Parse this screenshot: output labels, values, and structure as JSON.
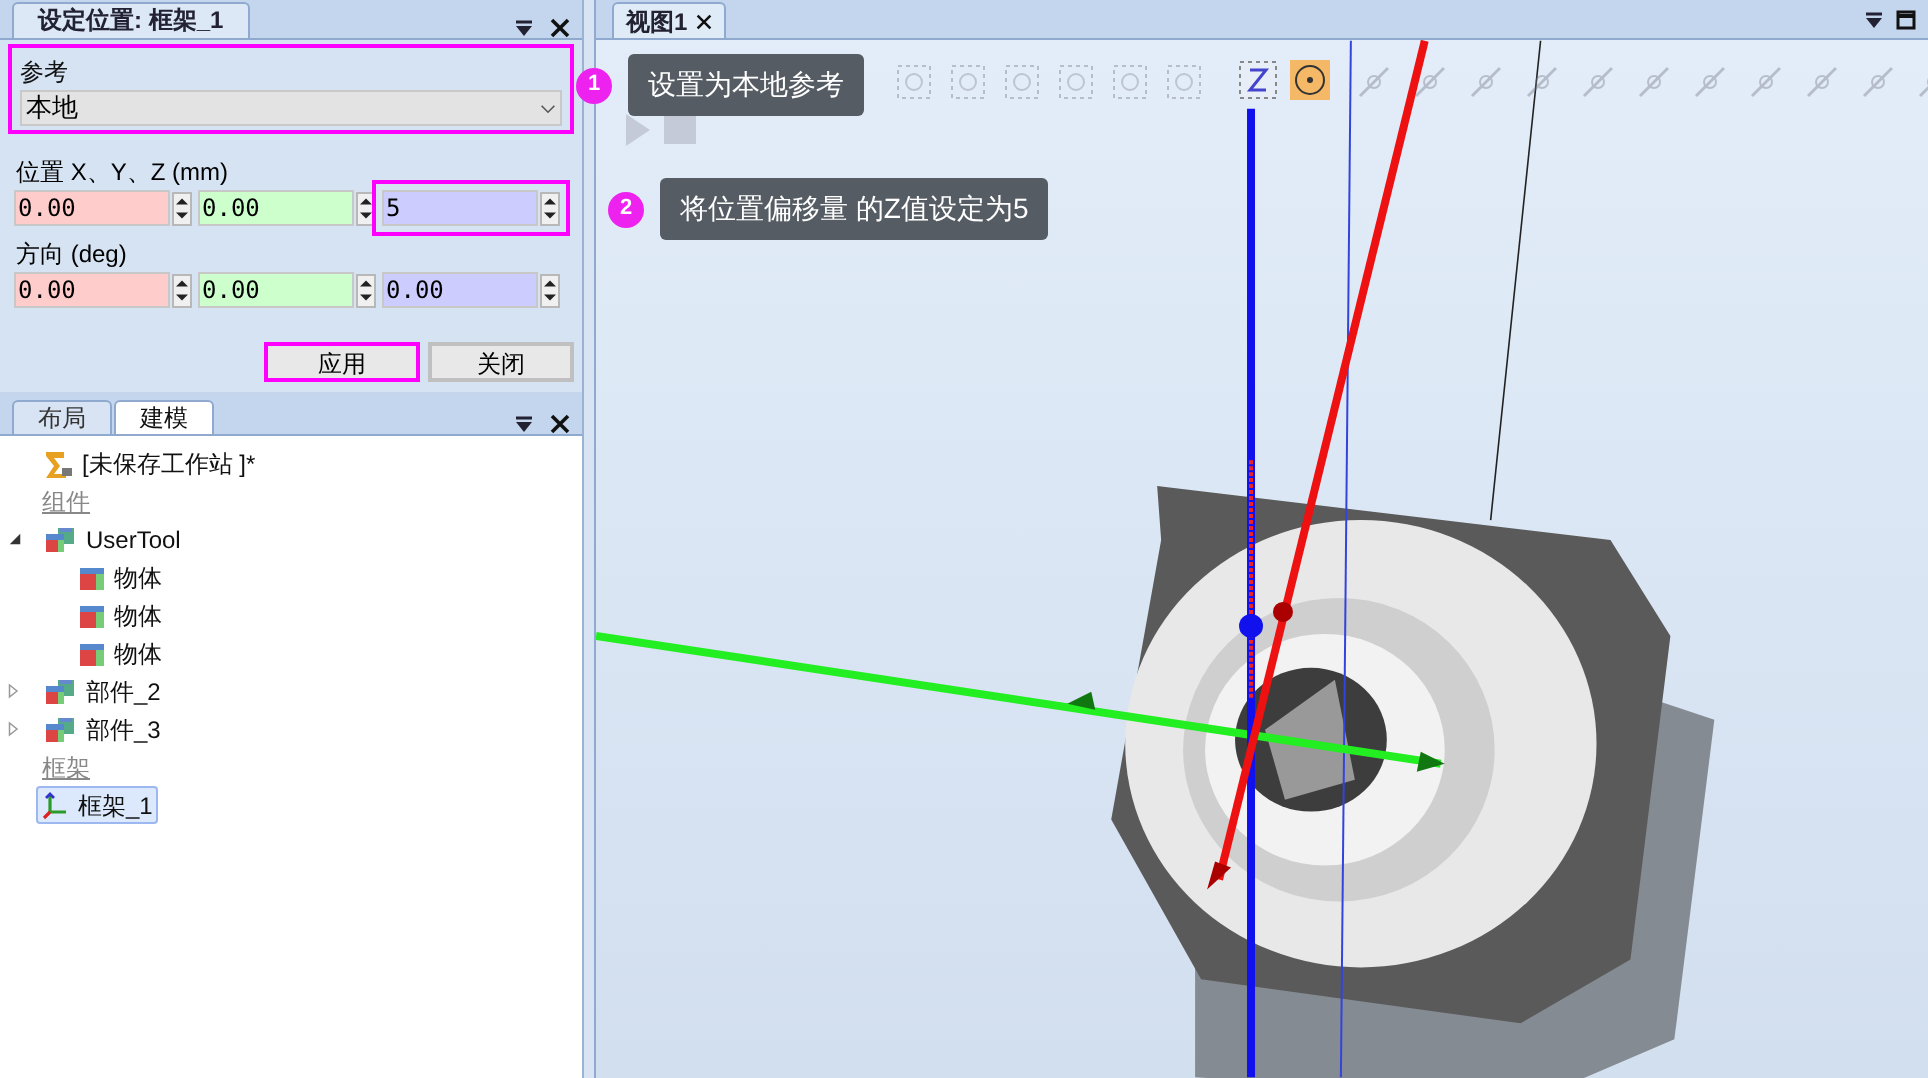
{
  "position_panel": {
    "title": "设定位置: 框架_1",
    "reference": {
      "label": "参考",
      "value": "本地",
      "highlighted": true
    },
    "position": {
      "label": "位置 X、Y、Z (mm)",
      "fields": [
        {
          "value": "0.00",
          "color": "#ffcccc",
          "highlighted": false
        },
        {
          "value": "0.00",
          "color": "#ccffcc",
          "highlighted": false
        },
        {
          "value": "5",
          "color": "#ccccff",
          "highlighted": true
        }
      ]
    },
    "orientation": {
      "label": "方向 (deg)",
      "fields": [
        {
          "value": "0.00",
          "color": "#ffcccc",
          "highlighted": false
        },
        {
          "value": "0.00",
          "color": "#ccffcc",
          "highlighted": false
        },
        {
          "value": "0.00",
          "color": "#ccccff",
          "highlighted": false
        }
      ]
    },
    "buttons": [
      {
        "label": "应用",
        "highlighted": true
      },
      {
        "label": "关闭",
        "highlighted": false
      }
    ]
  },
  "model_panel": {
    "tabs": [
      {
        "label": "布局",
        "selected": false
      },
      {
        "label": "建模",
        "selected": true
      }
    ],
    "tree": [
      {
        "kind": "station",
        "label": "[未保存工作站 ]*",
        "selected": false
      },
      {
        "kind": "category",
        "label": "组件",
        "selected": false
      },
      {
        "kind": "assembly",
        "label": "UserTool",
        "expanded": true,
        "selected": false,
        "children": [
          {
            "kind": "body",
            "label": "物体",
            "selected": false
          },
          {
            "kind": "body",
            "label": "物体",
            "selected": false
          },
          {
            "kind": "body",
            "label": "物体",
            "selected": false
          }
        ]
      },
      {
        "kind": "assembly",
        "label": "部件_2",
        "expanded": false,
        "selected": false
      },
      {
        "kind": "assembly",
        "label": "部件_3",
        "expanded": false,
        "selected": false
      },
      {
        "kind": "category",
        "label": "框架",
        "selected": false
      },
      {
        "kind": "frame",
        "label": "框架_1",
        "selected": true
      }
    ]
  },
  "viewport": {
    "tab": "视图1"
  },
  "callouts": [
    {
      "number": "1",
      "text": "设置为本地参考"
    },
    {
      "number": "2",
      "text": "将位置偏移量 的Z值设定为5"
    }
  ]
}
